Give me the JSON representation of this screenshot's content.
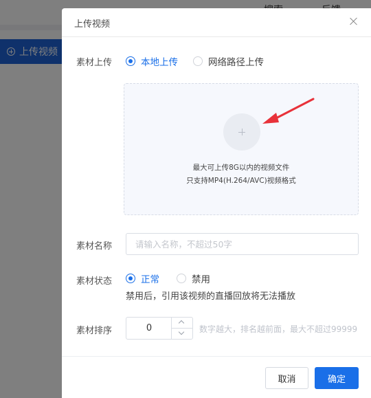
{
  "background": {
    "top_items": [
      "搜索",
      "反馈"
    ],
    "side_button_label": "上传视频"
  },
  "modal": {
    "title": "上传视频",
    "material_upload": {
      "label": "素材上传",
      "options": [
        {
          "label": "本地上传",
          "checked": true
        },
        {
          "label": "网络路径上传",
          "checked": false
        }
      ]
    },
    "upload_area": {
      "hint_line1": "最大可上传8G以内的视频文件",
      "hint_line2": "只支持MP4(H.264/AVC)视频格式"
    },
    "material_name": {
      "label": "素材名称",
      "placeholder": "请输入名称，不超过50字",
      "value": ""
    },
    "material_status": {
      "label": "素材状态",
      "options": [
        {
          "label": "正常",
          "checked": true
        },
        {
          "label": "禁用",
          "checked": false
        }
      ],
      "hint": "禁用后，引用该视频的直播回放将无法播放"
    },
    "material_sort": {
      "label": "素材排序",
      "value": "0",
      "hint": "数字越大，排名越前面，最大不超过99999"
    },
    "footer": {
      "cancel_label": "取消",
      "ok_label": "确定"
    }
  },
  "colors": {
    "primary": "#1a6fe8",
    "arrow": "#e8323a",
    "side_button": "#1e63d6"
  }
}
